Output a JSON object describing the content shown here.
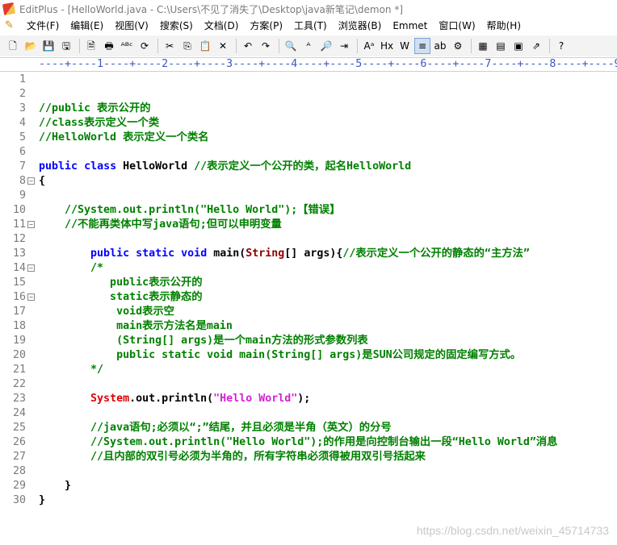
{
  "window": {
    "title": "EditPlus - [HelloWorld.java - C:\\Users\\不见了消失了\\Desktop\\java新笔记\\demon *]"
  },
  "menu": {
    "items": [
      "文件(F)",
      "编辑(E)",
      "视图(V)",
      "搜索(S)",
      "文档(D)",
      "方案(P)",
      "工具(T)",
      "浏览器(B)",
      "Emmet",
      "窗口(W)",
      "帮助(H)"
    ]
  },
  "toolbar": {
    "icons": [
      "new-file-icon",
      "open-icon",
      "save-icon",
      "save-all-icon",
      "print-preview-icon",
      "print-icon",
      "spellcheck-icon",
      "refresh-icon",
      "cut-icon",
      "copy-icon",
      "paste-icon",
      "delete-icon",
      "undo-icon",
      "redo-icon",
      "find-icon",
      "replace-icon",
      "find-in-files-icon",
      "goto-icon",
      "font-size-icon",
      "hx-icon",
      "word-wrap-icon",
      "align-icon",
      "abc-icon",
      "settings-icon",
      "window-icon",
      "browser-icon",
      "html-toolbar-icon",
      "external-icon",
      "help-icon"
    ],
    "glyphs": [
      "🗋",
      "📂",
      "💾",
      "🖫",
      "🗎",
      "🖶",
      "ᴬᴮᶜ",
      "⟳",
      "✂",
      "⎘",
      "📋",
      "✕",
      "↶",
      "↷",
      "🔍",
      "ᴬ",
      "🔎",
      "⇥",
      "Aᵃ",
      "Hx",
      "W",
      "≡",
      "ab",
      "⚙",
      "▦",
      "▤",
      "▣",
      "⇗",
      "?"
    ]
  },
  "ruler": {
    "text": "----+----1----+----2----+----3----+----4----+----5----+----6----+----7----+----8----+----9"
  },
  "editor": {
    "lines": [
      {
        "n": "1",
        "fold": "",
        "segments": []
      },
      {
        "n": "2",
        "fold": "",
        "segments": []
      },
      {
        "n": "3",
        "fold": "",
        "segments": [
          {
            "t": "//public 表示公开的",
            "c": "cm"
          }
        ]
      },
      {
        "n": "4",
        "fold": "",
        "segments": [
          {
            "t": "//class表示定义一个类",
            "c": "cm"
          }
        ]
      },
      {
        "n": "5",
        "fold": "",
        "segments": [
          {
            "t": "//HelloWorld 表示定义一个类名",
            "c": "cm"
          }
        ]
      },
      {
        "n": "6",
        "fold": "",
        "segments": []
      },
      {
        "n": "7",
        "fold": "",
        "segments": [
          {
            "t": "public",
            "c": "kw"
          },
          {
            "t": " ",
            "c": "tx"
          },
          {
            "t": "class",
            "c": "kw"
          },
          {
            "t": " HelloWorld ",
            "c": "tx"
          },
          {
            "t": "//表示定义一个公开的类，起名HelloWorld",
            "c": "cm"
          }
        ]
      },
      {
        "n": "8",
        "fold": "⊟",
        "segments": [
          {
            "t": "{",
            "c": "tx"
          }
        ]
      },
      {
        "n": "9",
        "fold": "",
        "segments": []
      },
      {
        "n": "10",
        "fold": "",
        "segments": [
          {
            "t": "    //System.out.println(\"Hello World\");【错误】",
            "c": "cm"
          }
        ]
      },
      {
        "n": "11",
        "fold": "⊟",
        "segments": [
          {
            "t": "    //不能再类体中写java语句;但可以申明变量",
            "c": "cm"
          }
        ]
      },
      {
        "n": "12",
        "fold": "",
        "segments": []
      },
      {
        "n": "13",
        "fold": "",
        "segments": [
          {
            "t": "        ",
            "c": "tx"
          },
          {
            "t": "public",
            "c": "kw"
          },
          {
            "t": " ",
            "c": "tx"
          },
          {
            "t": "static",
            "c": "kw"
          },
          {
            "t": " ",
            "c": "tx"
          },
          {
            "t": "void",
            "c": "kw"
          },
          {
            "t": " main(",
            "c": "tx"
          },
          {
            "t": "String",
            "c": "tp"
          },
          {
            "t": "[] args){",
            "c": "tx"
          },
          {
            "t": "//表示定义一个公开的静态的“主方法”",
            "c": "cm"
          }
        ]
      },
      {
        "n": "14",
        "fold": "⊟",
        "segments": [
          {
            "t": "        /*",
            "c": "cm"
          }
        ]
      },
      {
        "n": "15",
        "fold": "",
        "segments": [
          {
            "t": "           public表示公开的",
            "c": "cm"
          }
        ]
      },
      {
        "n": "16",
        "fold": "⊟",
        "segments": [
          {
            "t": "           static表示静态的",
            "c": "cm"
          }
        ]
      },
      {
        "n": "17",
        "fold": "",
        "segments": [
          {
            "t": "            void表示空",
            "c": "cm"
          }
        ]
      },
      {
        "n": "18",
        "fold": "",
        "segments": [
          {
            "t": "            main表示方法名是main",
            "c": "cm"
          }
        ]
      },
      {
        "n": "19",
        "fold": "",
        "segments": [
          {
            "t": "            (String[] args)是一个main方法的形式参数列表",
            "c": "cm"
          }
        ]
      },
      {
        "n": "20",
        "fold": "",
        "segments": [
          {
            "t": "            public static void main(String[] args)是SUN公司规定的固定编写方式。",
            "c": "cm"
          }
        ]
      },
      {
        "n": "21",
        "fold": "",
        "segments": [
          {
            "t": "        */",
            "c": "cm"
          }
        ]
      },
      {
        "n": "22",
        "fold": "",
        "segments": []
      },
      {
        "n": "23",
        "fold": "",
        "segments": [
          {
            "t": "        ",
            "c": "tx"
          },
          {
            "t": "System",
            "c": "sy"
          },
          {
            "t": ".out.println(",
            "c": "tx"
          },
          {
            "t": "\"Hello World\"",
            "c": "st"
          },
          {
            "t": ");",
            "c": "tx"
          }
        ]
      },
      {
        "n": "24",
        "fold": "",
        "segments": []
      },
      {
        "n": "25",
        "fold": "",
        "segments": [
          {
            "t": "        //java语句;必须以“;”结尾，并且必须是半角（英文）的分号",
            "c": "cm"
          }
        ]
      },
      {
        "n": "26",
        "fold": "",
        "segments": [
          {
            "t": "        //System.out.println(\"Hello World\");的作用是向控制台输出一段“Hello World”消息",
            "c": "cm"
          }
        ]
      },
      {
        "n": "27",
        "fold": "",
        "segments": [
          {
            "t": "        //且内部的双引号必须为半角的，所有字符串必须得被用双引号括起来",
            "c": "cm"
          }
        ]
      },
      {
        "n": "28",
        "fold": "",
        "segments": []
      },
      {
        "n": "29",
        "fold": "",
        "segments": [
          {
            "t": "    }",
            "c": "tx"
          }
        ]
      },
      {
        "n": "30",
        "fold": "",
        "segments": [
          {
            "t": "}",
            "c": "tx"
          }
        ]
      }
    ]
  },
  "watermark": "https://blog.csdn.net/weixin_45714733"
}
